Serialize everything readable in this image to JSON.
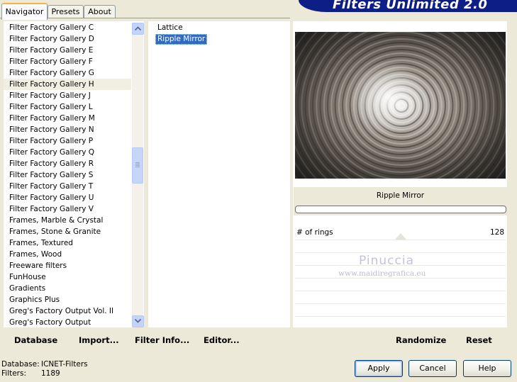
{
  "tabs": [
    "Navigator",
    "Presets",
    "About"
  ],
  "banner_title": "Filters Unlimited 2.0",
  "categories": [
    "Filter Factory Gallery C",
    "Filter Factory Gallery D",
    "Filter Factory Gallery E",
    "Filter Factory Gallery F",
    "Filter Factory Gallery G",
    "Filter Factory Gallery H",
    "Filter Factory Gallery J",
    "Filter Factory Gallery L",
    "Filter Factory Gallery M",
    "Filter Factory Gallery N",
    "Filter Factory Gallery P",
    "Filter Factory Gallery Q",
    "Filter Factory Gallery R",
    "Filter Factory Gallery S",
    "Filter Factory Gallery T",
    "Filter Factory Gallery U",
    "Filter Factory Gallery V",
    "Frames, Marble & Crystal",
    "Frames, Stone & Granite",
    "Frames, Textured",
    "Frames, Wood",
    "Freeware filters",
    "FunHouse",
    "Gradients",
    "Graphics Plus",
    "Greg's Factory Output Vol. II",
    "Greg's Factory Output"
  ],
  "filters": [
    "Lattice",
    "Ripple Mirror"
  ],
  "selected_filter": "Ripple Mirror",
  "preview_name": "Ripple Mirror",
  "param": {
    "label": "# of rings",
    "value": "128"
  },
  "watermark": {
    "line1": "Pinuccia",
    "line2": "www.maidiregrafica.eu"
  },
  "left_actions": {
    "database": "Database",
    "import": "Import...",
    "filter_info": "Filter Info...",
    "editor": "Editor..."
  },
  "right_actions": {
    "randomize": "Randomize",
    "reset": "Reset"
  },
  "status": {
    "database_label": "Database:",
    "database_value": "ICNET-Filters",
    "filters_label": "Filters:",
    "filters_value": "1189"
  },
  "buttons": {
    "apply": "Apply",
    "cancel": "Cancel",
    "help": "Help"
  },
  "colors": {
    "selection": "#316ac5",
    "banner": "#0d1e86",
    "tab_highlight": "#f9b13f"
  }
}
